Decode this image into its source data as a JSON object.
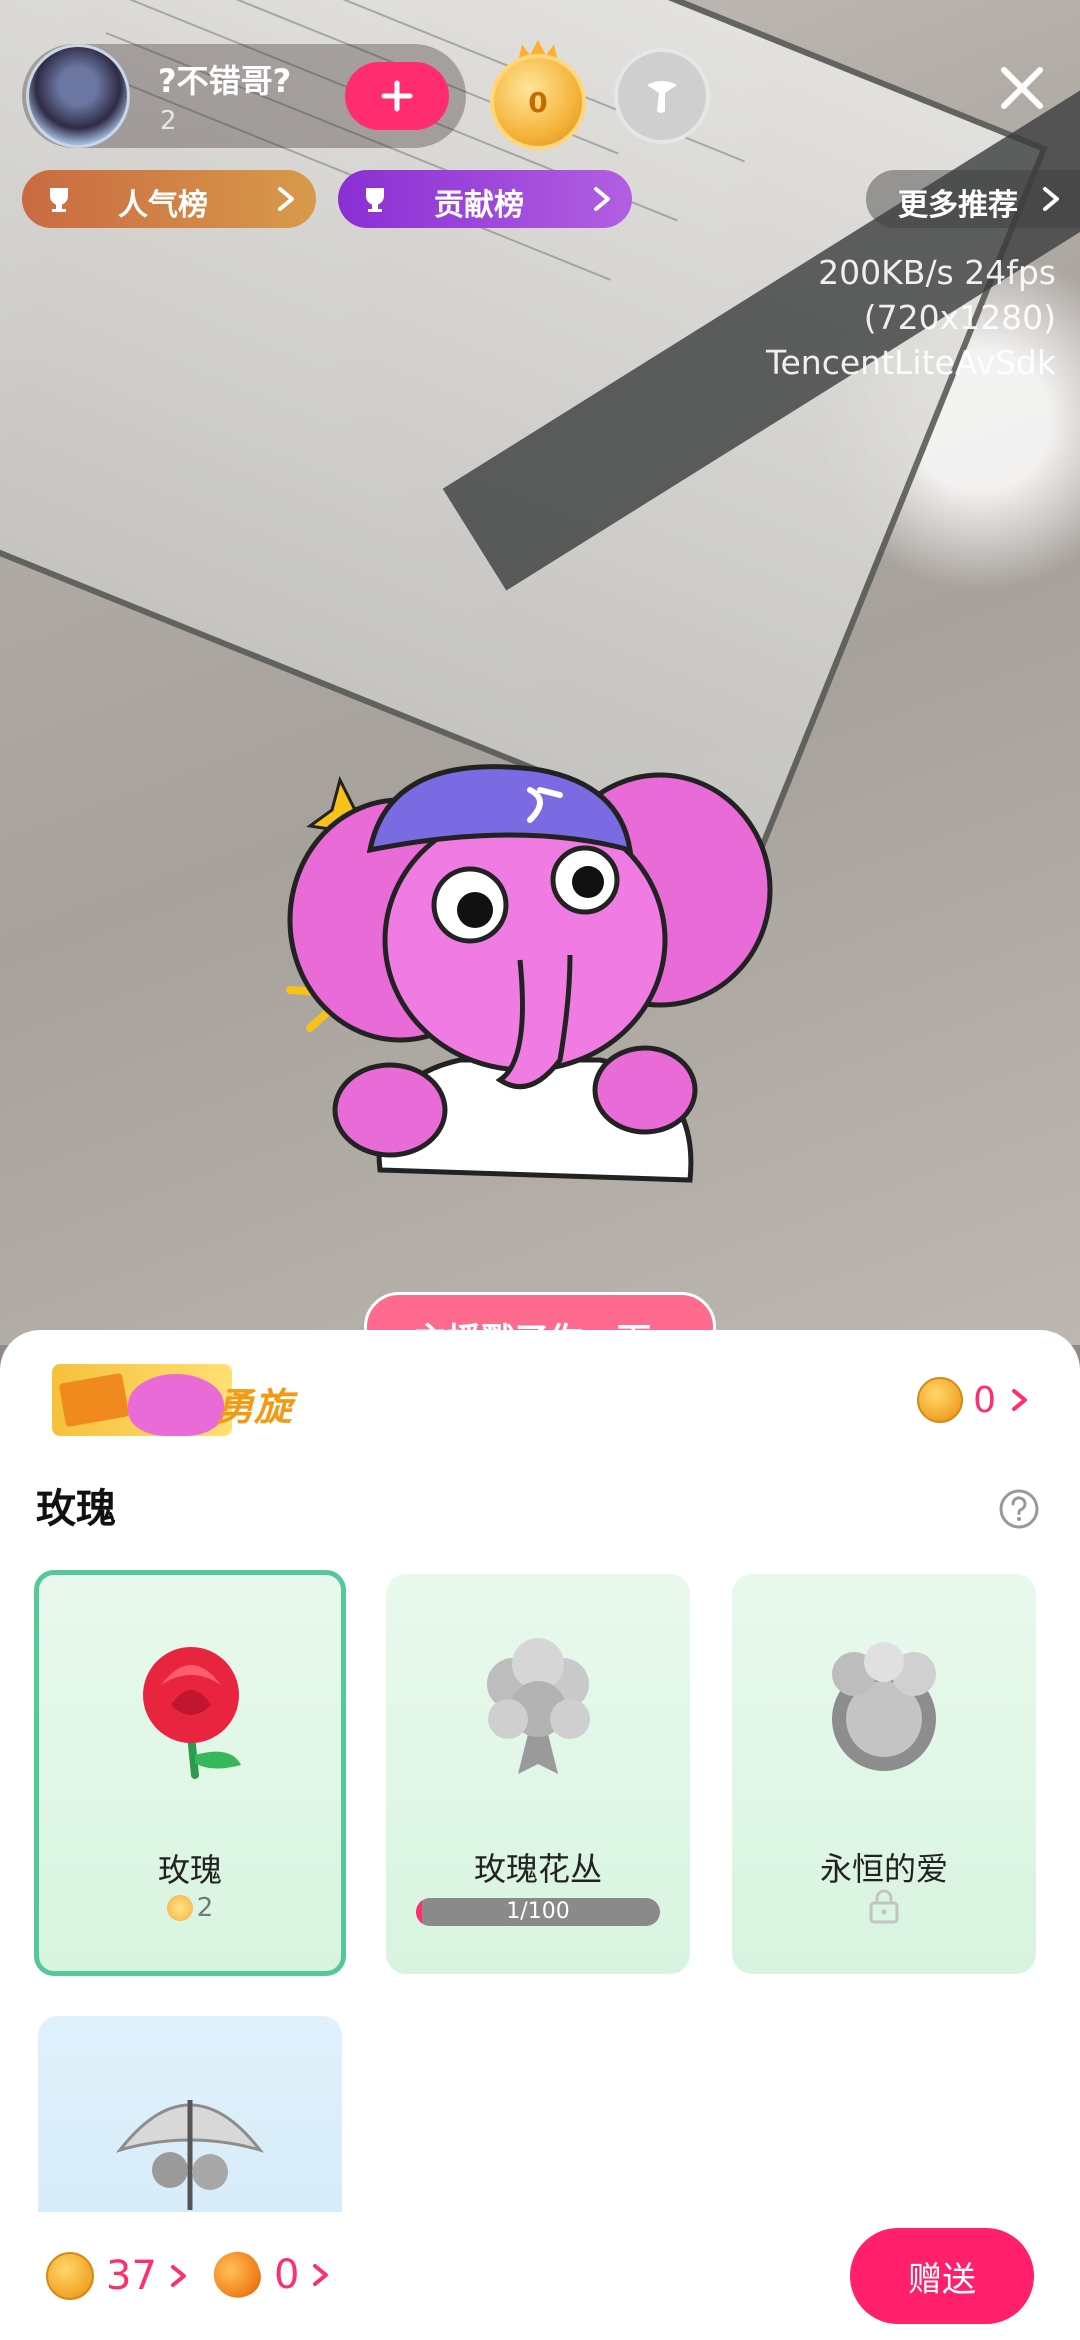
{
  "host": {
    "name": "?不错哥?",
    "count": "2"
  },
  "badge": {
    "level": "0"
  },
  "ranks": {
    "popularity": "人气榜",
    "contribution": "贡献榜",
    "more": "更多推荐"
  },
  "stream": {
    "line1": "200KB/s 24fps",
    "line2": "(720x1280)",
    "line3": "TencentLiteAvSdk"
  },
  "banner": {
    "text": "主播戳了你一下"
  },
  "gift_panel": {
    "promo_text": "勇旋",
    "balance_top": "0",
    "section_title": "玫瑰",
    "gifts": [
      {
        "name": "玫瑰",
        "price": "2",
        "selected": true
      },
      {
        "name": "玫瑰花丛",
        "progress_text": "1/100",
        "progress_value": 0.01
      },
      {
        "name": "永恒的爱",
        "locked": true
      },
      {
        "name": ""
      }
    ]
  },
  "bottom": {
    "coins": "37",
    "beans": "0",
    "send_label": "赠送"
  },
  "colors": {
    "accent": "#ff1f6a",
    "selected_border": "#55c89a"
  }
}
